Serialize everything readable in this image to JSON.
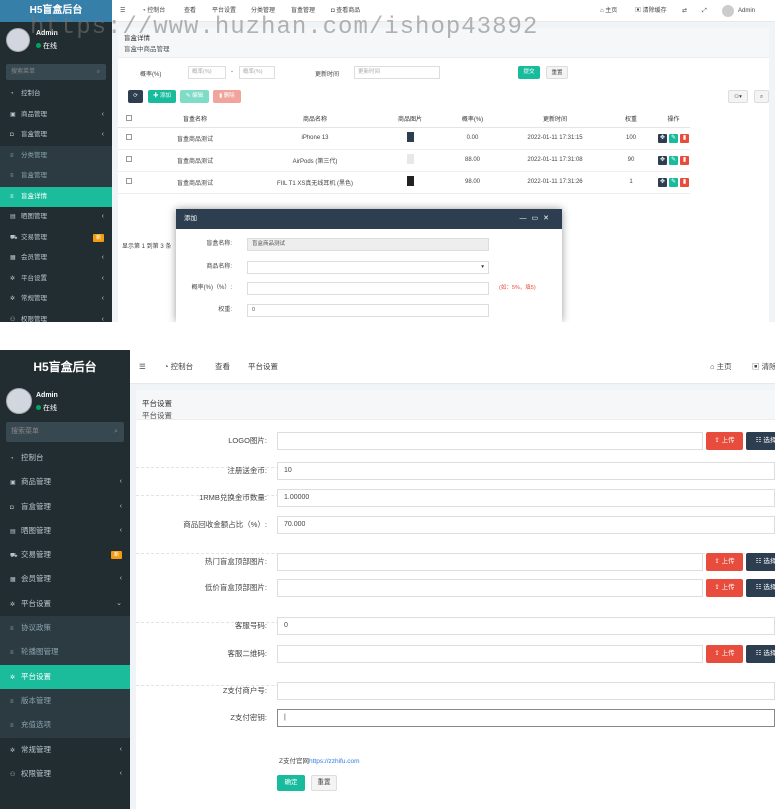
{
  "watermark": "https://www.huzhan.com/ishop43892",
  "shot1": {
    "brand": "H5盲盒后台",
    "user_name": "Admin",
    "user_status": "在线",
    "side_search": "搜索菜单",
    "nav": [
      {
        "label": "控制台",
        "icon": "dashboard-icon"
      },
      {
        "label": "商品管理",
        "icon": "gift-icon",
        "arrow": "‹"
      },
      {
        "label": "盲盒管理",
        "icon": "box-icon",
        "arrow": "‹"
      },
      {
        "label": "分类管理",
        "icon": "list-icon",
        "sub": true
      },
      {
        "label": "盲盒管理",
        "icon": "list-icon",
        "sub": true
      },
      {
        "label": "盲盒详情",
        "icon": "list-icon",
        "active": true
      },
      {
        "label": "晒图管理",
        "icon": "image-icon",
        "arrow": "‹"
      },
      {
        "label": "交易管理",
        "icon": "cart-icon",
        "badge": "新"
      },
      {
        "label": "会员管理",
        "icon": "user-icon",
        "arrow": "‹"
      },
      {
        "label": "平台设置",
        "icon": "cog-icon",
        "arrow": "‹"
      },
      {
        "label": "常规管理",
        "icon": "cogs-icon",
        "arrow": "‹"
      },
      {
        "label": "权限管理",
        "icon": "group-icon",
        "arrow": "‹"
      }
    ],
    "topnav": [
      "控制台",
      "查看",
      "平台设置",
      "分类管理",
      "盲盒管理",
      "查看商品"
    ],
    "top_right": {
      "home": "主页",
      "clear": "清除缓存",
      "admin": "Admin"
    },
    "panel_title": "盲盒详情",
    "panel_subtitle": "盲盒中商品管理",
    "filter": {
      "prob_label": "概率(%)",
      "min_placeholder": "概率(%)",
      "dash": "-",
      "max_placeholder": "概率(%)",
      "time_label": "更新时间",
      "time_placeholder": "更新时间",
      "submit": "提交",
      "reset": "重置"
    },
    "toolbar": {
      "add": "添加",
      "edit": "编辑",
      "delete": "删除"
    },
    "table": {
      "headers": [
        "盲盒名称",
        "商品名称",
        "商品图片",
        "概率(%)",
        "更新时间",
        "权重",
        "操作"
      ],
      "rows": [
        {
          "box": "盲盒商品测试",
          "goods": "iPhone 13",
          "prob": "0.00",
          "time": "2022-01-11 17:31:15",
          "weight": "100"
        },
        {
          "box": "盲盒商品测试",
          "goods": "AirPods (第三代)",
          "prob": "88.00",
          "time": "2022-01-11 17:31:08",
          "weight": "90"
        },
        {
          "box": "盲盒商品测试",
          "goods": "FIIL T1 XS真无线耳机 (黑色)",
          "prob": "98.00",
          "time": "2022-01-11 17:31:26",
          "weight": "1"
        }
      ]
    },
    "pager": "显示第 1 到第 3 条",
    "modal": {
      "title": "添加",
      "box_label": "盲盒名称:",
      "box_value": "盲盒商品测试",
      "goods_label": "商品名称:",
      "prob_label": "概率(%)（%）:",
      "prob_hint": "(如：5%，填5)",
      "weight_label": "权重:",
      "weight_value": "0"
    }
  },
  "shot2": {
    "brand": "H5盲盒后台",
    "user_name": "Admin",
    "user_status": "在线",
    "side_search": "搜索菜单",
    "nav": [
      {
        "label": "控制台",
        "icon": "dashboard-icon"
      },
      {
        "label": "商品管理",
        "icon": "gift-icon",
        "arrow": "‹"
      },
      {
        "label": "盲盒管理",
        "icon": "box-icon",
        "arrow": "‹"
      },
      {
        "label": "晒图管理",
        "icon": "image-icon",
        "arrow": "‹"
      },
      {
        "label": "交易管理",
        "icon": "cart-icon",
        "badge": "新"
      },
      {
        "label": "会员管理",
        "icon": "user-icon",
        "arrow": "‹"
      },
      {
        "label": "平台设置",
        "icon": "cog-icon",
        "arrow": "⌄"
      },
      {
        "label": "协议政策",
        "icon": "list-icon",
        "sub": true
      },
      {
        "label": "轮播图管理",
        "icon": "list-icon",
        "sub": true
      },
      {
        "label": "平台设置",
        "icon": "cog-icon",
        "active": true
      },
      {
        "label": "版本管理",
        "icon": "list-icon",
        "sub": true
      },
      {
        "label": "充值选项",
        "icon": "list-icon",
        "sub": true
      },
      {
        "label": "常规管理",
        "icon": "cogs-icon",
        "arrow": "‹"
      },
      {
        "label": "权限管理",
        "icon": "group-icon",
        "arrow": "‹"
      }
    ],
    "topnav": [
      "控制台",
      "查看",
      "平台设置"
    ],
    "top_right": {
      "home": "主页",
      "clear": "清除"
    },
    "panel_title": "平台设置",
    "panel_subtitle": "平台设置",
    "upload": "上传",
    "choose": "选择",
    "fields": [
      {
        "label": "LOGO图片:",
        "value": "",
        "upload": true
      },
      {
        "label": "注册送金币:",
        "value": "10"
      },
      {
        "label": "1RMB兑换金币数量:",
        "value": "1.00000"
      },
      {
        "label": "商品回收金额占比（%）:",
        "value": "70.000"
      },
      {
        "label": "热门盲盒顶部图片:",
        "value": "",
        "upload": true
      },
      {
        "label": "低价盲盒顶部图片:",
        "value": "",
        "upload": true
      },
      {
        "label": "客服号码:",
        "value": "0"
      },
      {
        "label": "客服二维码:",
        "value": "",
        "upload": true
      },
      {
        "label": "Z支付商户号:",
        "value": ""
      },
      {
        "label": "Z支付密钥:",
        "value": "|"
      }
    ],
    "zpay_hint_prefix": "Z支付官网",
    "zpay_hint_link": "https://zzhifu.com",
    "confirm": "确定",
    "reset": "重置"
  }
}
